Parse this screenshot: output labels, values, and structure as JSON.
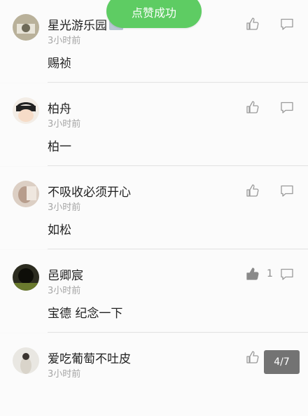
{
  "toast": {
    "text": "点赞成功"
  },
  "pager": {
    "text": "4/7"
  },
  "comments": [
    {
      "username": "星光游乐园",
      "time": "3小时前",
      "content": "赐祯",
      "likes": "",
      "liked": false
    },
    {
      "username": "柏舟",
      "time": "3小时前",
      "content": "柏一",
      "likes": "",
      "liked": false
    },
    {
      "username": "不吸收必须开心",
      "time": "3小时前",
      "content": "如松",
      "likes": "",
      "liked": false
    },
    {
      "username": "邑卿宸",
      "time": "3小时前",
      "content": "宝德 纪念一下",
      "likes": "1",
      "liked": true
    },
    {
      "username": "爱吃葡萄不吐皮",
      "time": "3小时前",
      "content": "",
      "likes": "",
      "liked": false
    }
  ],
  "icons": {
    "like": "thumbs-up-icon",
    "reply": "comment-bubble-icon"
  },
  "colors": {
    "toast_bg": "#5ecc63",
    "icon": "#9a9a9a",
    "liked_icon": "#8a8a8a"
  }
}
